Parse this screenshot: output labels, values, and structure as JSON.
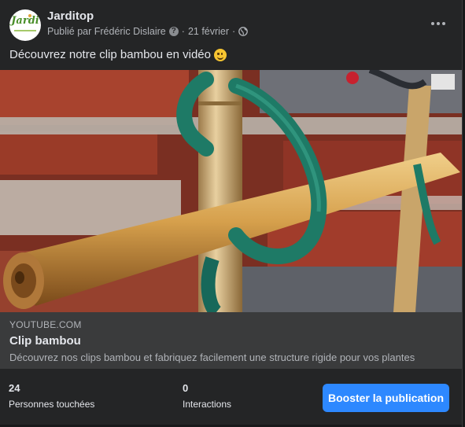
{
  "post": {
    "page_name": "Jarditop",
    "avatar_logo_text": "Jardi",
    "byline": "Publié par Frédéric Dislaire",
    "help_glyph": "?",
    "separator": "·",
    "date": "21 février",
    "privacy_icon": "globe-icon",
    "more_icon": "more-horizontal-icon",
    "message": "Découvrez notre clip bambou en vidéo",
    "message_emoji": "slightly-smiling-face-emoji"
  },
  "link": {
    "domain": "YOUTUBE.COM",
    "title": "Clip bambou",
    "description": "Découvrez nos clips bambou et fabriquez facilement une structure rigide pour vos plantes"
  },
  "stats": {
    "reach_value": "24",
    "reach_label": "Personnes touchées",
    "interactions_value": "0",
    "interactions_label": "Interactions"
  },
  "actions": {
    "boost_label": "Booster la publication"
  },
  "colors": {
    "background": "#18191a",
    "card": "#242526",
    "link_box": "#3a3b3c",
    "primary_text": "#e4e6eb",
    "secondary_text": "#b0b3b8",
    "accent": "#2d88ff"
  }
}
